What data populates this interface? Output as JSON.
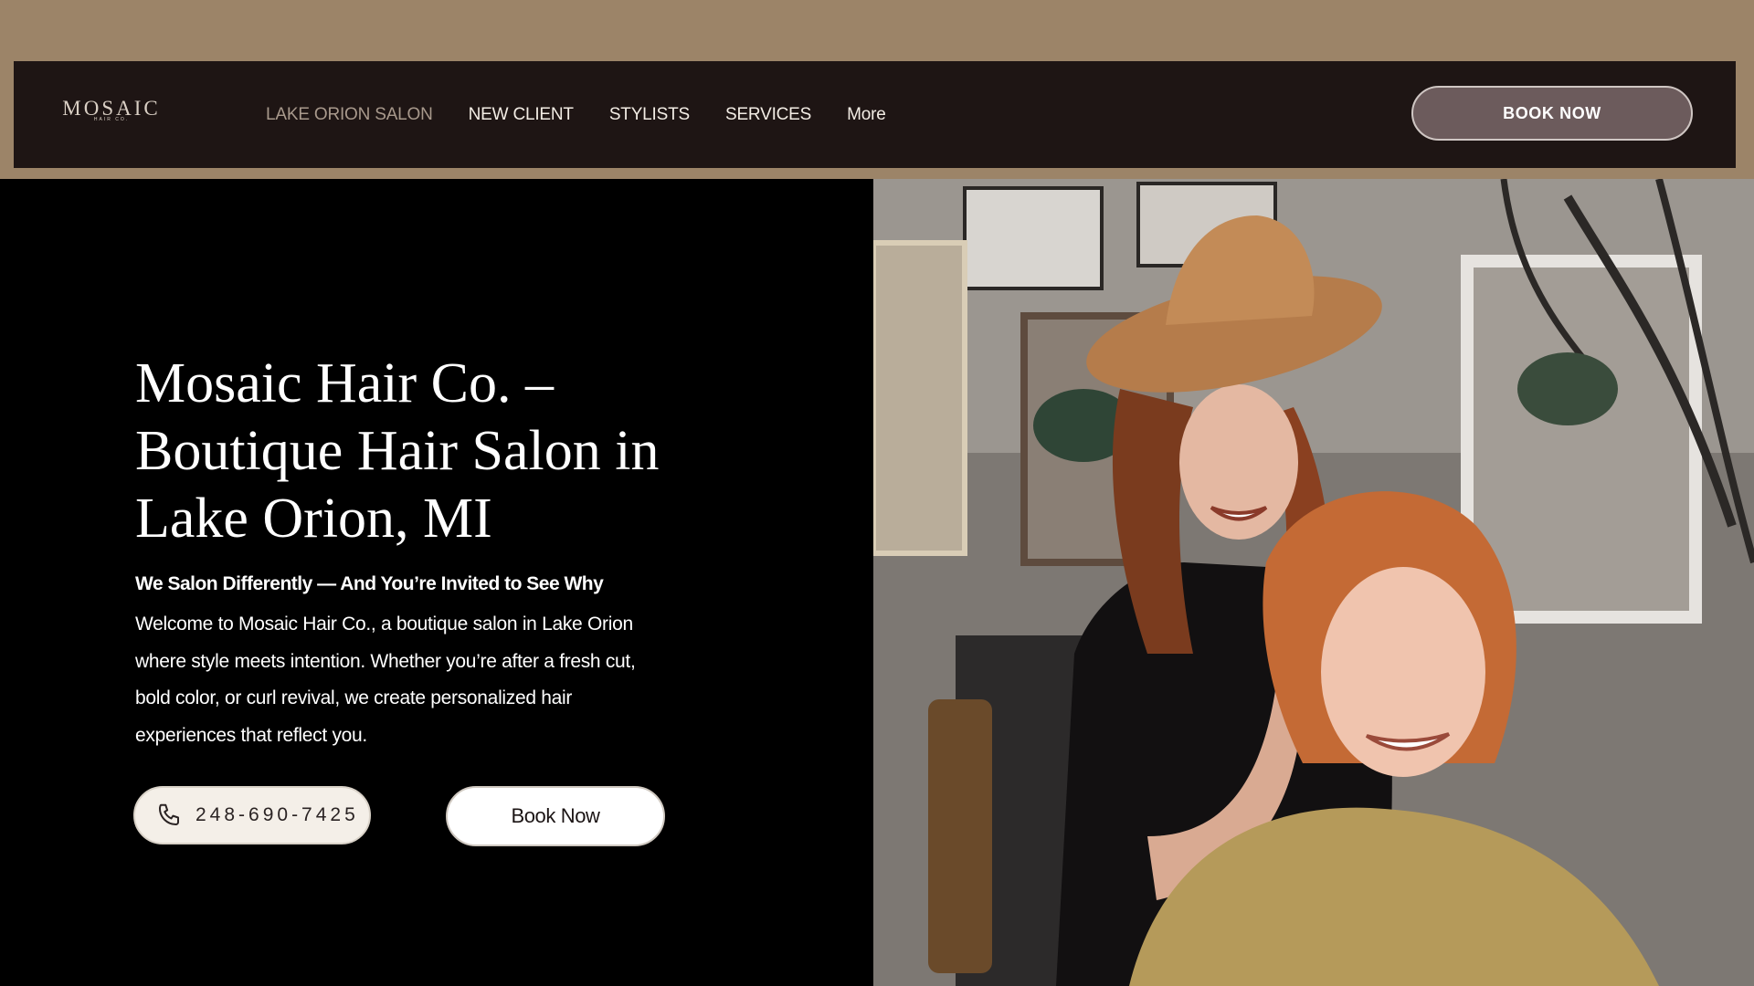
{
  "header": {
    "logo_text": "MOSAIC",
    "logo_subtext": "HAIR CO.",
    "nav": [
      {
        "label": "LAKE ORION SALON",
        "active": true
      },
      {
        "label": "NEW CLIENT",
        "active": false
      },
      {
        "label": "STYLISTS",
        "active": false
      },
      {
        "label": "SERVICES",
        "active": false
      },
      {
        "label": "More",
        "active": false
      }
    ],
    "book_button": "BOOK NOW"
  },
  "hero": {
    "title": "Mosaic Hair Co. – Boutique Hair Salon in Lake Orion, MI",
    "subheading": "We Salon Differently — And You’re Invited to See Why",
    "paragraph": "Welcome to Mosaic Hair Co., a boutique salon in Lake Orion where style meets intention. Whether you’re after a fresh cut, bold color, or curl revival, we create personalized hair experiences that reflect you.",
    "phone": "248-690-7425",
    "phone_icon": "phone-icon",
    "book_button": "Book Now"
  },
  "colors": {
    "top_band": "#9c8468",
    "navbar": "#1e1514",
    "book_top_bg": "#6c5b5c",
    "hero_left_bg": "#000000"
  }
}
